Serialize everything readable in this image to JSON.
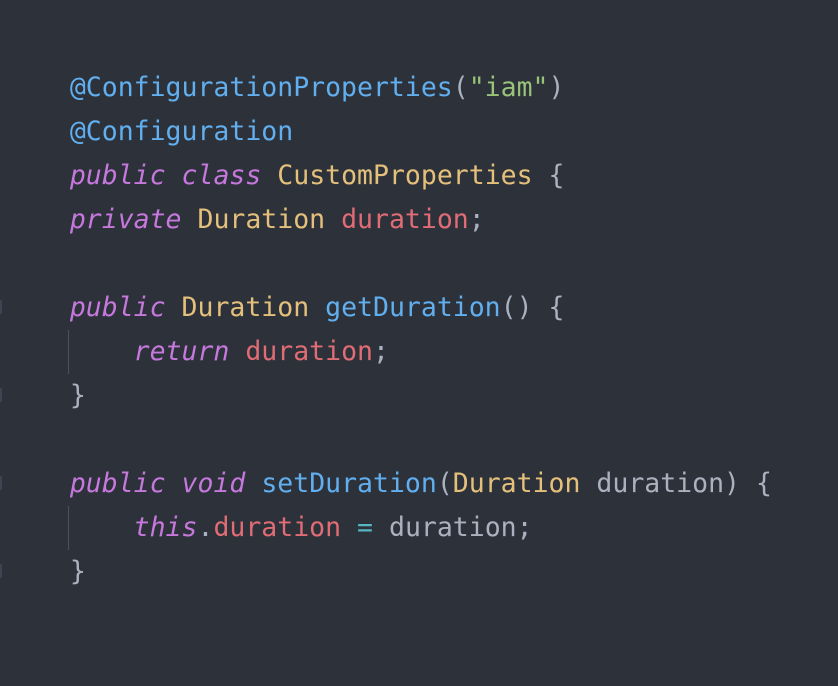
{
  "colors": {
    "background": "#2c313a",
    "annotation": "#61afef",
    "string": "#98c379",
    "keyword": "#c678dd",
    "type": "#e5c07b",
    "field": "#e06c75",
    "function": "#61afef",
    "operator": "#56b6c2",
    "text": "#abb2bf"
  },
  "code": {
    "l1": {
      "at": "@ConfigurationProperties",
      "p1": "(",
      "s": "\"iam\"",
      "p2": ")"
    },
    "l2": {
      "at": "@Configuration"
    },
    "l3": {
      "k1": "public",
      "k2": "class",
      "name": "CustomProperties",
      "brace": "{"
    },
    "l5": {
      "k1": "private",
      "t": "Duration",
      "f": "duration",
      "semi": ";"
    },
    "l7": {
      "k1": "public",
      "t": "Duration",
      "fn": "getDuration",
      "p": "()",
      "brace": "{"
    },
    "l8": {
      "k1": "return",
      "f": "duration",
      "semi": ";"
    },
    "l9": {
      "brace": "}"
    },
    "l11": {
      "k1": "public",
      "k2": "void",
      "fn": "setDuration",
      "p1": "(",
      "t": "Duration",
      "param": "duration",
      "p2": ")",
      "brace": "{"
    },
    "l12": {
      "k1": "this",
      "dot": ".",
      "f": "duration",
      "eq": "=",
      "val": "duration",
      "semi": ";"
    },
    "l13": {
      "brace": "}"
    },
    "l15": {
      "brace": "}"
    }
  }
}
